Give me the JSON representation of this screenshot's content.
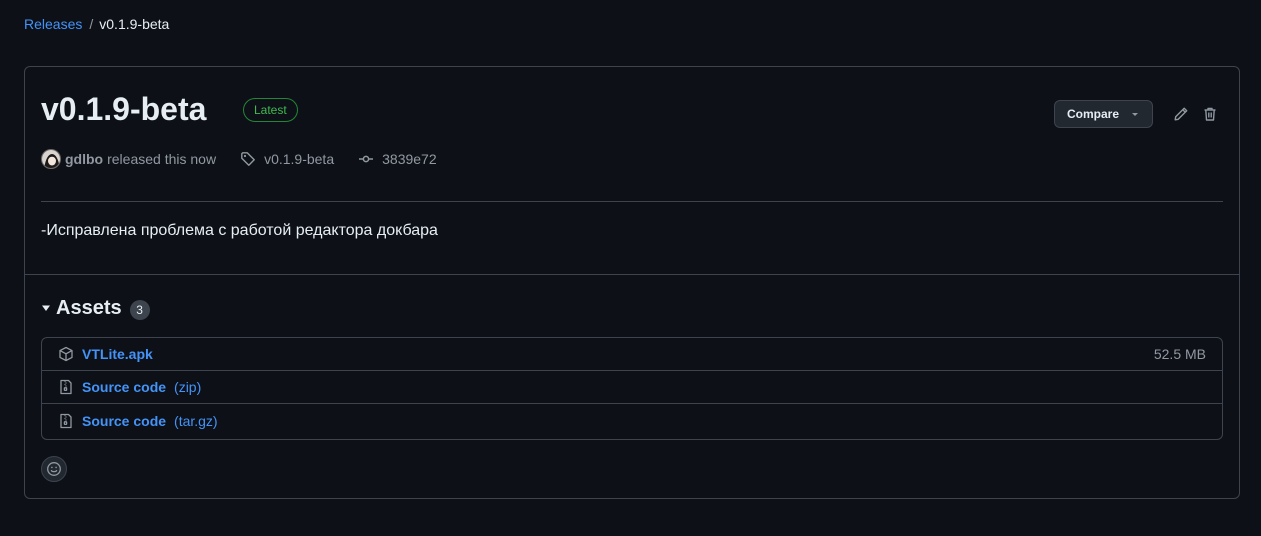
{
  "breadcrumb": {
    "parent": "Releases",
    "separator": "/",
    "current": "v0.1.9-beta"
  },
  "release": {
    "title": "v0.1.9-beta",
    "badge": "Latest",
    "compare_label": "Compare",
    "author": "gdlbo",
    "released_text": "released this now",
    "tag": "v0.1.9-beta",
    "commit": "3839e72",
    "notes": "-Исправлена проблема с работой редактора докбара"
  },
  "assets": {
    "title": "Assets",
    "count": "3",
    "items": [
      {
        "name": "VTLite.apk",
        "ext": "",
        "size": "52.5 MB",
        "icon": "package-icon"
      },
      {
        "name": "Source code",
        "ext": "(zip)",
        "size": "",
        "icon": "file-zip-icon"
      },
      {
        "name": "Source code",
        "ext": "(tar.gz)",
        "size": "",
        "icon": "file-zip-icon"
      }
    ]
  },
  "colors": {
    "background": "#0d1117",
    "border": "#3d444d",
    "link": "#4493f8",
    "badge_green": "#3fb950",
    "muted_text": "#9198a1"
  }
}
